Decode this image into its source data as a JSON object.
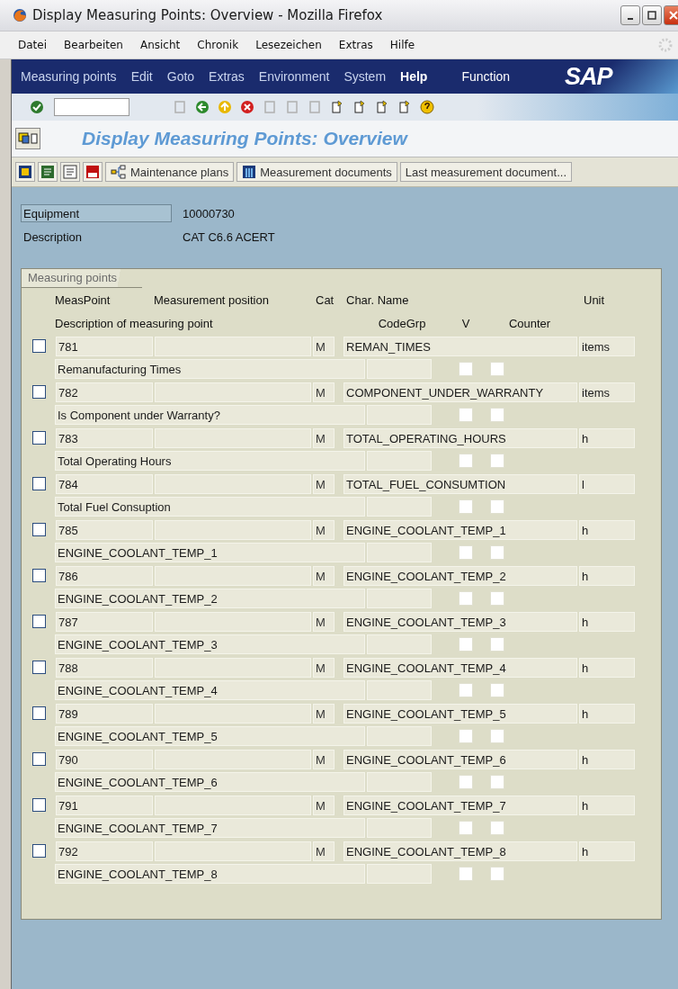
{
  "window": {
    "title": "Display Measuring Points: Overview - Mozilla Firefox"
  },
  "browser_menu": [
    "Datei",
    "Bearbeiten",
    "Ansicht",
    "Chronik",
    "Lesezeichen",
    "Extras",
    "Hilfe"
  ],
  "sap_menu": {
    "items": [
      "Measuring points",
      "Edit",
      "Goto",
      "Extras",
      "Environment",
      "System"
    ],
    "help": "Help",
    "function": "Function",
    "logo": "SAP"
  },
  "screen_title": "Display Measuring Points: Overview",
  "app_toolbar": {
    "buttons": [
      "Maintenance plans",
      "Measurement documents",
      "Last measurement document..."
    ]
  },
  "header_fields": [
    {
      "label": "Equipment",
      "value": "10000730",
      "kind": "boxed"
    },
    {
      "label": "Description",
      "value": "CAT C6.6 ACERT",
      "kind": "plain"
    }
  ],
  "measuring_points": {
    "tab": "Measuring points",
    "columns_line_1": [
      "MeasPoint",
      "Measurement position",
      "Cat",
      "Char. Name",
      "Unit"
    ],
    "columns_line_2": [
      "Description of measuring point",
      "CodeGrp",
      "V",
      "Counter"
    ],
    "rows": [
      {
        "meas_point": "781",
        "cat": "M",
        "char_name": "REMAN_TIMES",
        "unit": "items",
        "description": "Remanufacturing Times",
        "selected": false,
        "v": false,
        "counter": false
      },
      {
        "meas_point": "782",
        "cat": "M",
        "char_name": "COMPONENT_UNDER_WARRANTY",
        "unit": "items",
        "description": "Is Component under Warranty?",
        "selected": false,
        "v": false,
        "counter": false
      },
      {
        "meas_point": "783",
        "cat": "M",
        "char_name": "TOTAL_OPERATING_HOURS",
        "unit": "h",
        "description": "Total Operating Hours",
        "selected": false,
        "v": false,
        "counter": false
      },
      {
        "meas_point": "784",
        "cat": "M",
        "char_name": "TOTAL_FUEL_CONSUMTION",
        "unit": "l",
        "description": "Total Fuel Consuption",
        "selected": false,
        "v": false,
        "counter": false
      },
      {
        "meas_point": "785",
        "cat": "M",
        "char_name": "ENGINE_COOLANT_TEMP_1",
        "unit": "h",
        "description": "ENGINE_COOLANT_TEMP_1",
        "selected": false,
        "v": false,
        "counter": false
      },
      {
        "meas_point": "786",
        "cat": "M",
        "char_name": "ENGINE_COOLANT_TEMP_2",
        "unit": "h",
        "description": "ENGINE_COOLANT_TEMP_2",
        "selected": false,
        "v": false,
        "counter": false
      },
      {
        "meas_point": "787",
        "cat": "M",
        "char_name": "ENGINE_COOLANT_TEMP_3",
        "unit": "h",
        "description": "ENGINE_COOLANT_TEMP_3",
        "selected": false,
        "v": false,
        "counter": false
      },
      {
        "meas_point": "788",
        "cat": "M",
        "char_name": "ENGINE_COOLANT_TEMP_4",
        "unit": "h",
        "description": "ENGINE_COOLANT_TEMP_4",
        "selected": false,
        "v": false,
        "counter": false
      },
      {
        "meas_point": "789",
        "cat": "M",
        "char_name": "ENGINE_COOLANT_TEMP_5",
        "unit": "h",
        "description": "ENGINE_COOLANT_TEMP_5",
        "selected": false,
        "v": false,
        "counter": false
      },
      {
        "meas_point": "790",
        "cat": "M",
        "char_name": "ENGINE_COOLANT_TEMP_6",
        "unit": "h",
        "description": "ENGINE_COOLANT_TEMP_6",
        "selected": false,
        "v": false,
        "counter": false
      },
      {
        "meas_point": "791",
        "cat": "M",
        "char_name": "ENGINE_COOLANT_TEMP_7",
        "unit": "h",
        "description": "ENGINE_COOLANT_TEMP_7",
        "selected": false,
        "v": false,
        "counter": false
      },
      {
        "meas_point": "792",
        "cat": "M",
        "char_name": "ENGINE_COOLANT_TEMP_8",
        "unit": "h",
        "description": "ENGINE_COOLANT_TEMP_8",
        "selected": false,
        "v": false,
        "counter": false
      }
    ]
  }
}
